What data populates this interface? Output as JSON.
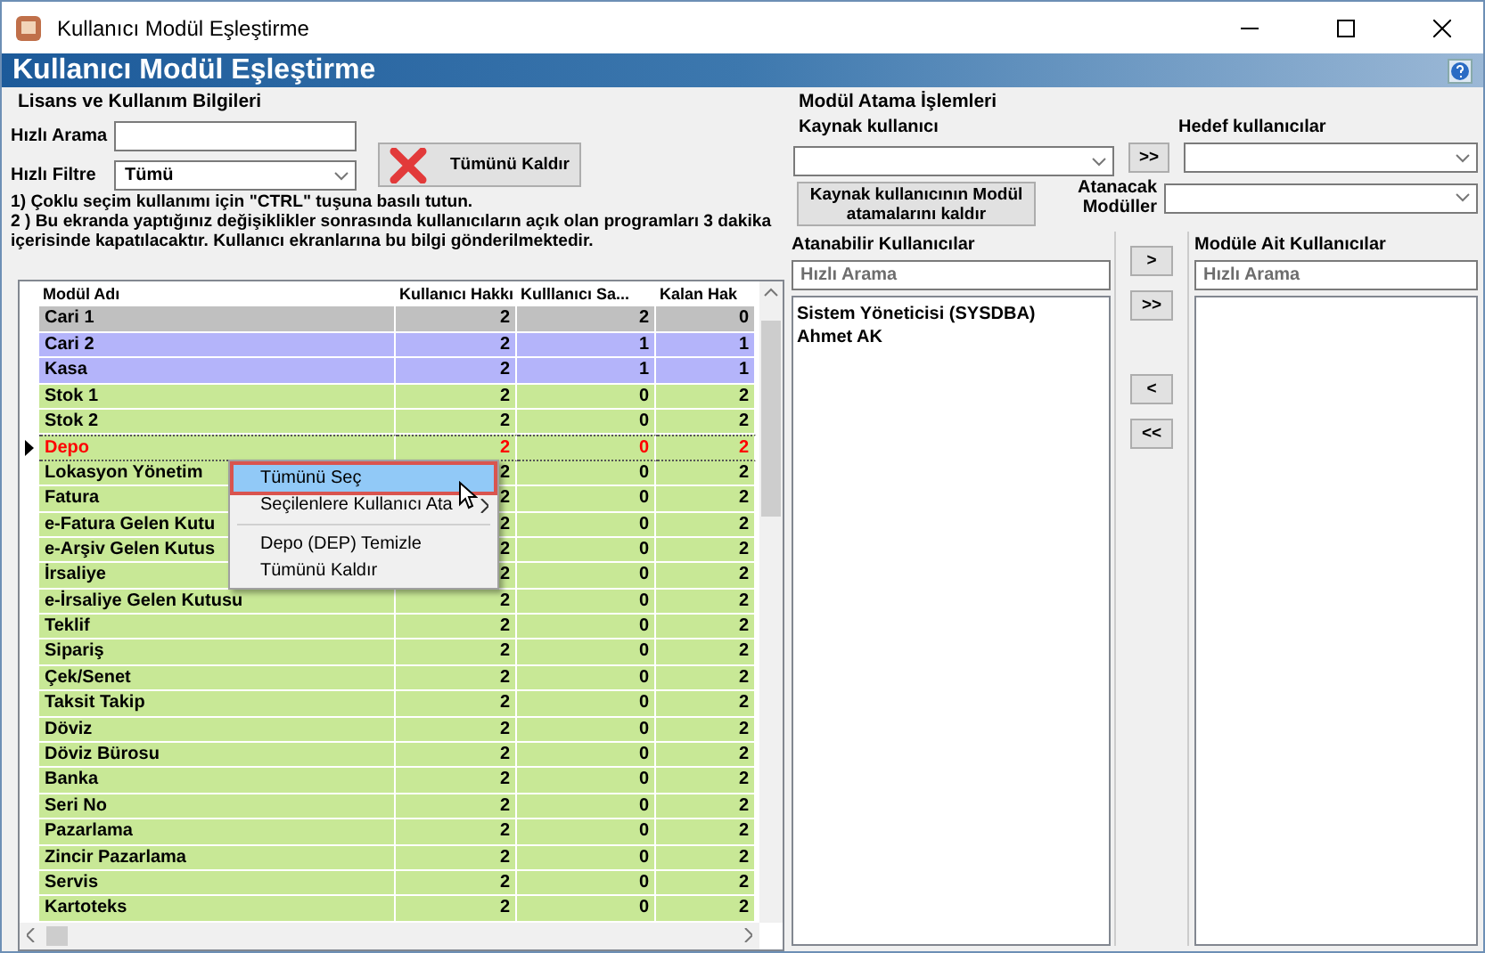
{
  "window": {
    "title": "Kullanıcı Modül Eşleştirme"
  },
  "header": {
    "title": "Kullanıcı Modül Eşleştirme"
  },
  "license_panel": {
    "title": "Lisans ve Kullanım Bilgileri",
    "search_label": "Hızlı Arama",
    "filter_label": "Hızlı Filtre",
    "filter_value": "Tümü",
    "remove_all_button": "Tümünü Kaldır",
    "notes": [
      "1) Çoklu seçim kullanımı için \"CTRL\" tuşuna basılı tutun.",
      "2 ) Bu ekranda yaptığınız değişiklikler sonrasında kullanıcıların açık olan programları 3 dakika içerisinde kapatılacaktır. Kullanıcı ekranlarına bu bilgi gönderilmektedir."
    ]
  },
  "grid": {
    "columns": [
      "Modül Adı",
      "Kullanıcı Hakkı",
      "Kulllanıcı Sa...",
      "Kalan Hak"
    ],
    "rows": [
      {
        "name": "Cari 1",
        "rights": "2",
        "used": "2",
        "remaining": "0",
        "color": "#c0c0c0",
        "selected": false
      },
      {
        "name": "Cari 2",
        "rights": "2",
        "used": "1",
        "remaining": "1",
        "color": "#b4b4fa",
        "selected": false
      },
      {
        "name": "Kasa",
        "rights": "2",
        "used": "1",
        "remaining": "1",
        "color": "#b4b4fa",
        "selected": false
      },
      {
        "name": "Stok 1",
        "rights": "2",
        "used": "0",
        "remaining": "2",
        "color": "#c8e896",
        "selected": false
      },
      {
        "name": "Stok 2",
        "rights": "2",
        "used": "0",
        "remaining": "2",
        "color": "#c8e896",
        "selected": false
      },
      {
        "name": "Depo",
        "rights": "2",
        "used": "0",
        "remaining": "2",
        "color": "#c8e896",
        "selected": true
      },
      {
        "name": "Lokasyon Yönetim",
        "rights": "2",
        "used": "0",
        "remaining": "2",
        "color": "#c8e896",
        "selected": false
      },
      {
        "name": "Fatura",
        "rights": "2",
        "used": "0",
        "remaining": "2",
        "color": "#c8e896",
        "selected": false
      },
      {
        "name": "e-Fatura Gelen Kutu",
        "rights": "2",
        "used": "0",
        "remaining": "2",
        "color": "#c8e896",
        "selected": false
      },
      {
        "name": "e-Arşiv Gelen Kutus",
        "rights": "2",
        "used": "0",
        "remaining": "2",
        "color": "#c8e896",
        "selected": false
      },
      {
        "name": "İrsaliye",
        "rights": "2",
        "used": "0",
        "remaining": "2",
        "color": "#c8e896",
        "selected": false
      },
      {
        "name": "e-İrsaliye Gelen Kutusu",
        "rights": "2",
        "used": "0",
        "remaining": "2",
        "color": "#c8e896",
        "selected": false
      },
      {
        "name": "Teklif",
        "rights": "2",
        "used": "0",
        "remaining": "2",
        "color": "#c8e896",
        "selected": false
      },
      {
        "name": "Sipariş",
        "rights": "2",
        "used": "0",
        "remaining": "2",
        "color": "#c8e896",
        "selected": false
      },
      {
        "name": "Çek/Senet",
        "rights": "2",
        "used": "0",
        "remaining": "2",
        "color": "#c8e896",
        "selected": false
      },
      {
        "name": "Taksit Takip",
        "rights": "2",
        "used": "0",
        "remaining": "2",
        "color": "#c8e896",
        "selected": false
      },
      {
        "name": "Döviz",
        "rights": "2",
        "used": "0",
        "remaining": "2",
        "color": "#c8e896",
        "selected": false
      },
      {
        "name": "Döviz Bürosu",
        "rights": "2",
        "used": "0",
        "remaining": "2",
        "color": "#c8e896",
        "selected": false
      },
      {
        "name": "Banka",
        "rights": "2",
        "used": "0",
        "remaining": "2",
        "color": "#c8e896",
        "selected": false
      },
      {
        "name": "Seri No",
        "rights": "2",
        "used": "0",
        "remaining": "2",
        "color": "#c8e896",
        "selected": false
      },
      {
        "name": "Pazarlama",
        "rights": "2",
        "used": "0",
        "remaining": "2",
        "color": "#c8e896",
        "selected": false
      },
      {
        "name": "Zincir Pazarlama",
        "rights": "2",
        "used": "0",
        "remaining": "2",
        "color": "#c8e896",
        "selected": false
      },
      {
        "name": "Servis",
        "rights": "2",
        "used": "0",
        "remaining": "2",
        "color": "#c8e896",
        "selected": false
      },
      {
        "name": "Kartoteks",
        "rights": "2",
        "used": "0",
        "remaining": "2",
        "color": "#c8e896",
        "selected": false
      }
    ]
  },
  "context_menu": {
    "items": [
      {
        "kind": "item",
        "label": "Tümünü Seç",
        "selected": true,
        "submenu": false
      },
      {
        "kind": "item",
        "label": "Seçilenlere Kullanıcı Ata",
        "selected": false,
        "submenu": true
      },
      {
        "kind": "separator"
      },
      {
        "kind": "item",
        "label": "Depo (DEP) Temizle",
        "selected": false,
        "submenu": false
      },
      {
        "kind": "item",
        "label": "Tümünü Kaldır",
        "selected": false,
        "submenu": false
      }
    ]
  },
  "assign_panel": {
    "title": "Modül Atama İşlemleri",
    "source_label": "Kaynak kullanıcı",
    "copy_button": ">>",
    "target_label": "Hedef kullanıcılar",
    "remove_source_button": "Kaynak kullanıcının Modül atamalarını kaldır",
    "modules_label": "Atanacak Modüller",
    "available": {
      "title": "Atanabilir Kullanıcılar",
      "placeholder": "Hızlı Arama",
      "items": [
        "Sistem Yöneticisi (SYSDBA)",
        "Ahmet  AK"
      ]
    },
    "move_buttons": [
      ">",
      ">>",
      "<",
      "<<"
    ],
    "assigned": {
      "title": "Modüle Ait Kullanıcılar",
      "placeholder": "Hızlı Arama"
    }
  }
}
